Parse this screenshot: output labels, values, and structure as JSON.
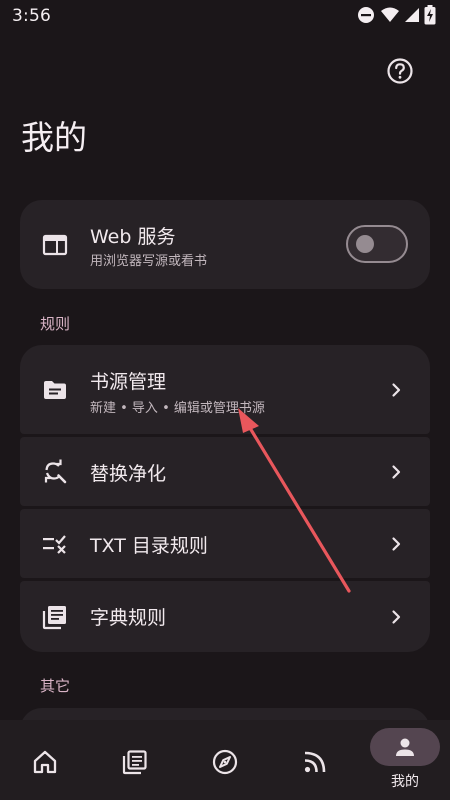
{
  "status_bar": {
    "time": "3:56",
    "icons": [
      "dnd-icon",
      "wifi-icon",
      "signal-icon",
      "battery-charging-icon"
    ]
  },
  "header": {
    "title": "我的",
    "help_icon": "help-circle-icon"
  },
  "web_service": {
    "title": "Web 服务",
    "subtitle": "用浏览器写源或看书",
    "icon": "web-window-icon",
    "enabled": false
  },
  "rules_section": {
    "label": "规则",
    "items": [
      {
        "title": "书源管理",
        "subtitle": "新建 • 导入 • 编辑或管理书源",
        "icon": "folder-icon"
      },
      {
        "title": "替换净化",
        "icon": "find-replace-icon"
      },
      {
        "title": "TXT 目录规则",
        "icon": "toc-rule-icon"
      },
      {
        "title": "字典规则",
        "icon": "library-books-icon"
      }
    ]
  },
  "other_section": {
    "label": "其它"
  },
  "bottom_nav": {
    "items": [
      {
        "icon": "home-icon"
      },
      {
        "icon": "bookshelf-icon"
      },
      {
        "icon": "compass-icon"
      },
      {
        "icon": "rss-icon"
      },
      {
        "icon": "person-icon",
        "label": "我的",
        "active": true
      }
    ]
  },
  "colors": {
    "background": "#1b1619",
    "card": "#272226",
    "section_label": "#d9b4c6",
    "nav_active_pill": "#544550",
    "annotation_arrow": "#e8575c"
  }
}
